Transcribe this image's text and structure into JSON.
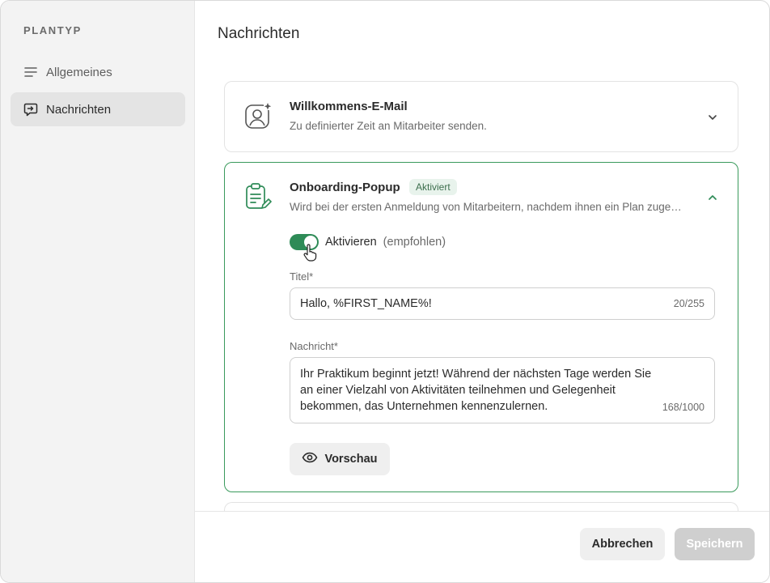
{
  "sidebar": {
    "title": "PLANTYP",
    "items": [
      {
        "label": "Allgemeines",
        "icon": "lines-icon",
        "active": false
      },
      {
        "label": "Nachrichten",
        "icon": "message-icon",
        "active": true
      }
    ]
  },
  "main": {
    "title": "Nachrichten",
    "cards": [
      {
        "title": "Willkommens-E-Mail",
        "subtitle": "Zu definierter Zeit an Mitarbeiter senden.",
        "icon": "user-sparkle-icon",
        "expanded": false
      },
      {
        "title": "Onboarding-Popup",
        "badge": "Aktiviert",
        "subtitle": "Wird bei der ersten Anmeldung von Mitarbeitern, nachdem ihnen ein Plan zuge…",
        "icon": "clipboard-edit-icon",
        "expanded": true,
        "toggle": {
          "label": "Aktivieren",
          "hint": "(empfohlen)",
          "on": true
        },
        "title_field": {
          "label": "Titel*",
          "value": "Hallo, %FIRST_NAME%!",
          "counter": "20/255"
        },
        "message_field": {
          "label": "Nachricht*",
          "value": "Ihr Praktikum beginnt jetzt! Während der nächsten Tage werden Sie an einer Vielzahl von Aktivitäten teilnehmen und Gelegenheit bekommen, das Unternehmen kennenzulernen.",
          "counter": "168/1000"
        },
        "preview_label": "Vorschau"
      }
    ]
  },
  "footer": {
    "cancel_label": "Abbrechen",
    "save_label": "Speichern"
  },
  "colors": {
    "accent": "#2e8b57",
    "card_border_active": "#3a9a5c",
    "sidebar_bg": "#f3f3f3"
  }
}
